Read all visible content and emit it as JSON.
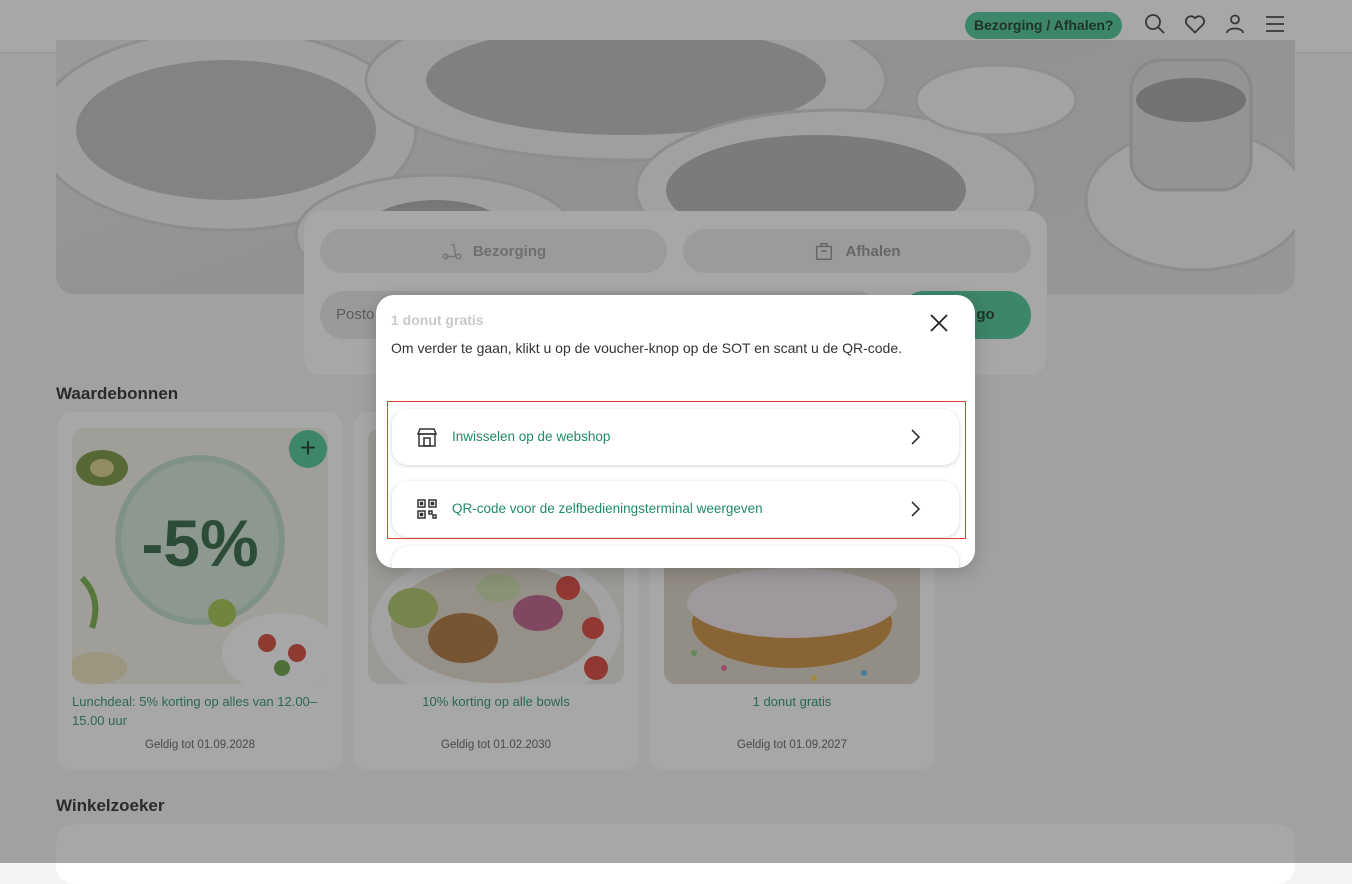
{
  "header": {
    "delivery_pill": "Bezorging / Afhalen?",
    "icons": [
      "search-icon",
      "heart-icon",
      "user-icon",
      "menu-icon"
    ]
  },
  "order_widget": {
    "delivery_label": "Bezorging",
    "pickup_label": "Afhalen",
    "postcode_placeholder": "Posto",
    "go_label": "go"
  },
  "vouchers": {
    "title": "Waardebonnen",
    "items": [
      {
        "image_text": "-5%",
        "title": "Lunchdeal: 5% korting op alles van 12.00–15.00 uur",
        "valid": "Geldig tot 01.09.2028"
      },
      {
        "title": "10% korting op alle bowls",
        "valid": "Geldig tot 01.02.2030"
      },
      {
        "title": "1 donut gratis",
        "valid": "Geldig tot 01.09.2027"
      }
    ]
  },
  "store_finder": {
    "title": "Winkelzoeker"
  },
  "modal": {
    "title": "1 donut gratis",
    "description": "Om verder te gaan, klikt u op de voucher-knop op de SOT en scant u de QR-code.",
    "options": [
      {
        "label": "Inwisselen op de webshop",
        "icon": "store-icon"
      },
      {
        "label": "QR-code voor de zelfbedieningsterminal weergeven",
        "icon": "qr-code-icon"
      }
    ]
  },
  "colors": {
    "accent": "#3cc48e",
    "link_text": "#1f8a6a",
    "highlight": "#d9432f"
  }
}
